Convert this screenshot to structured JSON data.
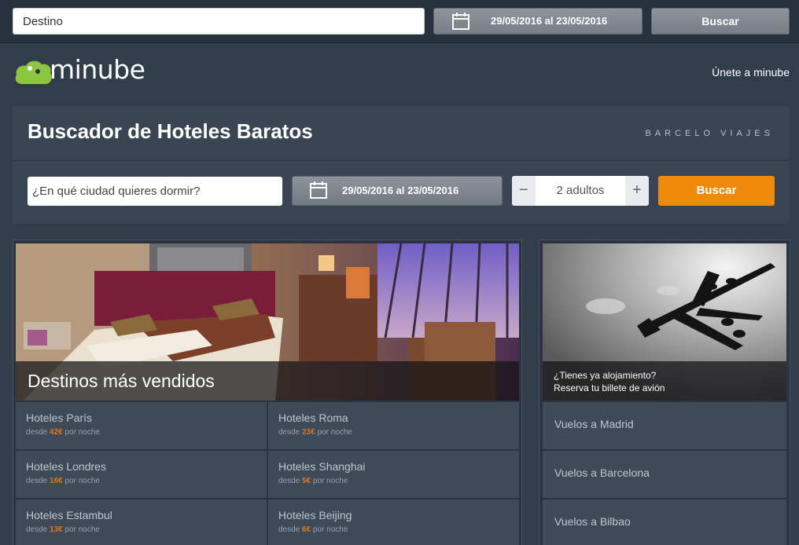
{
  "topbar": {
    "destination_placeholder": "Destino",
    "dates": "29/05/2016 al 23/05/2016",
    "search_label": "Buscar"
  },
  "brand": {
    "logo_text": "minube",
    "join_label": "Únete a minube"
  },
  "search_panel": {
    "title": "Buscador de Hoteles Baratos",
    "partner": "BARCELO VIAJES",
    "city_placeholder": "¿En qué ciudad quieres dormir?",
    "dates": "29/05/2016 al 23/05/2016",
    "guests_minus": "−",
    "guests_value": "2 adultos",
    "guests_plus": "+",
    "search_label": "Buscar",
    "accent_color": "#f08a0c"
  },
  "destinations": {
    "heading": "Destinos más vendidos",
    "price_prefix": "desde",
    "price_suffix": "por noche",
    "items": [
      {
        "name": "Hoteles París",
        "price": "42€"
      },
      {
        "name": "Hoteles Roma",
        "price": "23€"
      },
      {
        "name": "Hoteles Londres",
        "price": "16€"
      },
      {
        "name": "Hoteles Shanghai",
        "price": "5€"
      },
      {
        "name": "Hoteles Estambul",
        "price": "13€"
      },
      {
        "name": "Hoteles Beijing",
        "price": "6€"
      }
    ]
  },
  "flights": {
    "caption_line1": "¿Tienes ya alojamiento?",
    "caption_line2": "Reserva tu billete de avión",
    "items": [
      {
        "label": "Vuelos a Madrid"
      },
      {
        "label": "Vuelos a Barcelona"
      },
      {
        "label": "Vuelos a Bilbao"
      }
    ]
  }
}
